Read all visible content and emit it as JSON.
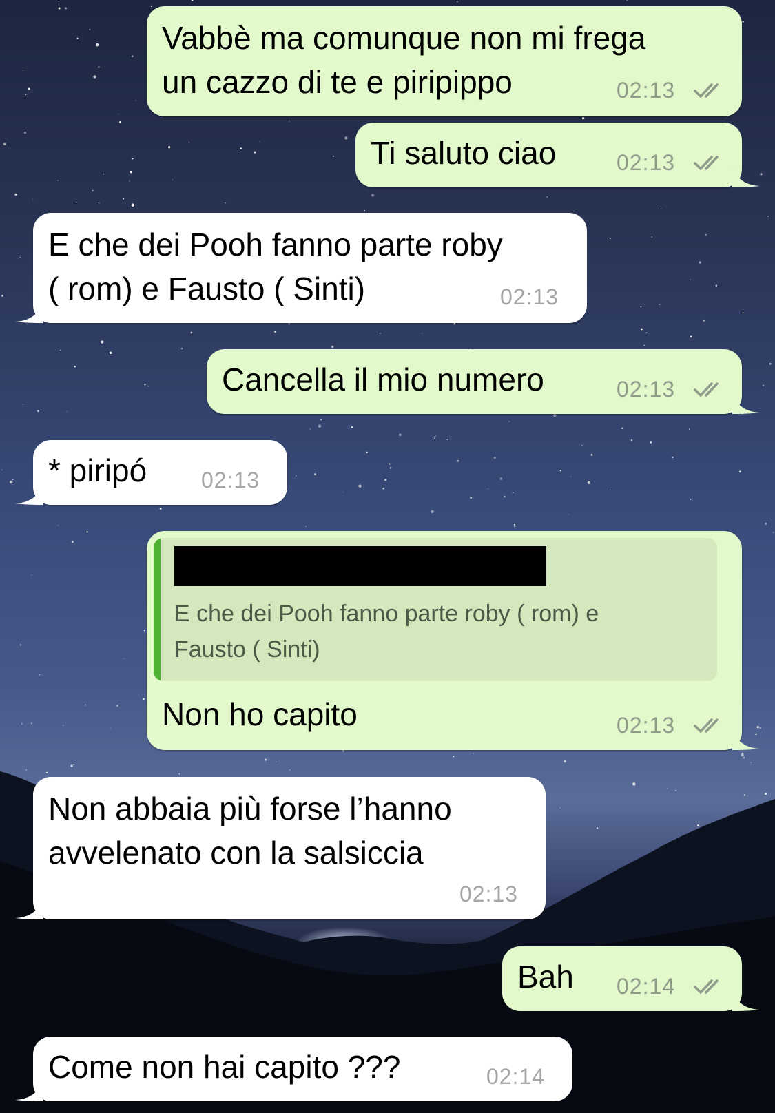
{
  "messages": [
    {
      "id": "m1",
      "direction": "outgoing",
      "text": "Vabbè ma comunque non mi frega\nun cazzo di te e piripippo",
      "time": "02:13"
    },
    {
      "id": "m2",
      "direction": "outgoing",
      "text": "Ti saluto ciao",
      "time": "02:13"
    },
    {
      "id": "m3",
      "direction": "incoming",
      "text": "E che dei Pooh fanno parte roby\n( rom) e Fausto ( Sinti)",
      "time": "02:13"
    },
    {
      "id": "m4",
      "direction": "outgoing",
      "text": "Cancella il mio numero",
      "time": "02:13"
    },
    {
      "id": "m5",
      "direction": "incoming",
      "text": "* piripó",
      "time": "02:13"
    },
    {
      "id": "m6",
      "direction": "outgoing",
      "quote": "E che dei Pooh fanno parte roby ( rom) e\nFausto ( Sinti)",
      "text": "Non ho capito",
      "time": "02:13"
    },
    {
      "id": "m7",
      "direction": "incoming",
      "text": "Non abbaia più forse l’hanno\navvelenato con la salsiccia",
      "time": "02:13"
    },
    {
      "id": "m8",
      "direction": "outgoing",
      "text": "Bah",
      "time": "02:14"
    },
    {
      "id": "m9",
      "direction": "incoming",
      "text": "Come non hai capito ???",
      "time": "02:14"
    }
  ],
  "colors": {
    "outgoing_bubble": "#e1f9cb",
    "incoming_bubble": "#ffffff",
    "quote_bar": "#4eb233",
    "read_ticks": "#8f9a8a"
  },
  "icons": {
    "read_receipt": "double-check-icon"
  }
}
